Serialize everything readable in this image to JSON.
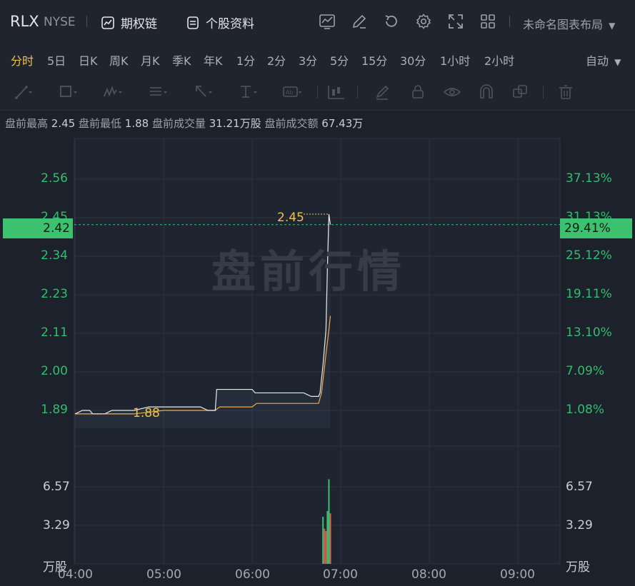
{
  "header": {
    "ticker": "RLX",
    "exchange": "NYSE",
    "options_label": "期权链",
    "profile_label": "个股资料",
    "layout_name": "未命名图表布局"
  },
  "periods": [
    "分时",
    "5日",
    "日K",
    "周K",
    "月K",
    "季K",
    "年K",
    "1分",
    "2分",
    "3分",
    "5分",
    "15分",
    "30分",
    "1小时",
    "2小时"
  ],
  "period_auto": "自动",
  "info": {
    "high_label": "盘前最高",
    "high_value": "2.45",
    "low_label": "盘前最低",
    "low_value": "1.88",
    "vol_label": "盘前成交量",
    "vol_value": "31.21万股",
    "amt_label": "盘前成交额",
    "amt_value": "67.43万"
  },
  "watermark": "盘前行情",
  "colors": {
    "up": "#3cc26f",
    "down": "#e05a4f",
    "price_line": "#ffffff",
    "avg_line": "#f0a94b",
    "accent": "#f2c14e"
  },
  "chart_data": {
    "type": "line",
    "x_ticks": [
      "04:00",
      "05:00",
      "06:00",
      "07:00",
      "08:00",
      "09:00"
    ],
    "price_ticks": [
      "2.56",
      "2.45",
      "2.34",
      "2.23",
      "2.11",
      "2.00",
      "1.89"
    ],
    "pct_ticks": [
      "37.13%",
      "31.13%",
      "25.12%",
      "19.11%",
      "13.10%",
      "7.09%",
      "1.08%"
    ],
    "volume_ticks": [
      "6.57",
      "3.29"
    ],
    "volume_unit": "万股",
    "ylim": [
      1.85,
      2.6
    ],
    "current_price": "2.42",
    "current_pct": "29.41%",
    "high_annotation": "2.45",
    "low_annotation": "1.88",
    "series": [
      {
        "name": "price",
        "points": [
          [
            "04:00",
            1.88
          ],
          [
            "04:05",
            1.89
          ],
          [
            "04:10",
            1.89
          ],
          [
            "04:12",
            1.88
          ],
          [
            "04:20",
            1.88
          ],
          [
            "04:25",
            1.89
          ],
          [
            "04:40",
            1.89
          ],
          [
            "04:50",
            1.9
          ],
          [
            "05:05",
            1.9
          ],
          [
            "05:25",
            1.9
          ],
          [
            "05:30",
            1.89
          ],
          [
            "05:35",
            1.89
          ],
          [
            "05:36",
            1.95
          ],
          [
            "05:40",
            1.95
          ],
          [
            "06:00",
            1.95
          ],
          [
            "06:02",
            1.94
          ],
          [
            "06:20",
            1.94
          ],
          [
            "06:35",
            1.94
          ],
          [
            "06:40",
            1.93
          ],
          [
            "06:45",
            1.93
          ],
          [
            "06:46",
            1.94
          ],
          [
            "06:48",
            2.02
          ],
          [
            "06:50",
            2.12
          ],
          [
            "06:51",
            2.3
          ],
          [
            "06:52",
            2.45
          ],
          [
            "06:53",
            2.42
          ]
        ]
      },
      {
        "name": "avg",
        "points": [
          [
            "04:00",
            1.88
          ],
          [
            "04:10",
            1.88
          ],
          [
            "04:40",
            1.88
          ],
          [
            "05:00",
            1.89
          ],
          [
            "05:35",
            1.89
          ],
          [
            "05:38",
            1.9
          ],
          [
            "06:00",
            1.9
          ],
          [
            "06:03",
            1.91
          ],
          [
            "06:30",
            1.91
          ],
          [
            "06:45",
            1.91
          ],
          [
            "06:47",
            1.94
          ],
          [
            "06:50",
            2.05
          ],
          [
            "06:52",
            2.12
          ],
          [
            "06:53",
            2.16
          ]
        ]
      }
    ],
    "volume": [
      {
        "t": "06:48",
        "v": 4.0,
        "dir": "up"
      },
      {
        "t": "06:49",
        "v": 3.0,
        "dir": "down"
      },
      {
        "t": "06:50",
        "v": 2.8,
        "dir": "down"
      },
      {
        "t": "06:51",
        "v": 4.5,
        "dir": "up"
      },
      {
        "t": "06:52",
        "v": 7.2,
        "dir": "up"
      },
      {
        "t": "06:53",
        "v": 4.3,
        "dir": "down"
      }
    ]
  }
}
